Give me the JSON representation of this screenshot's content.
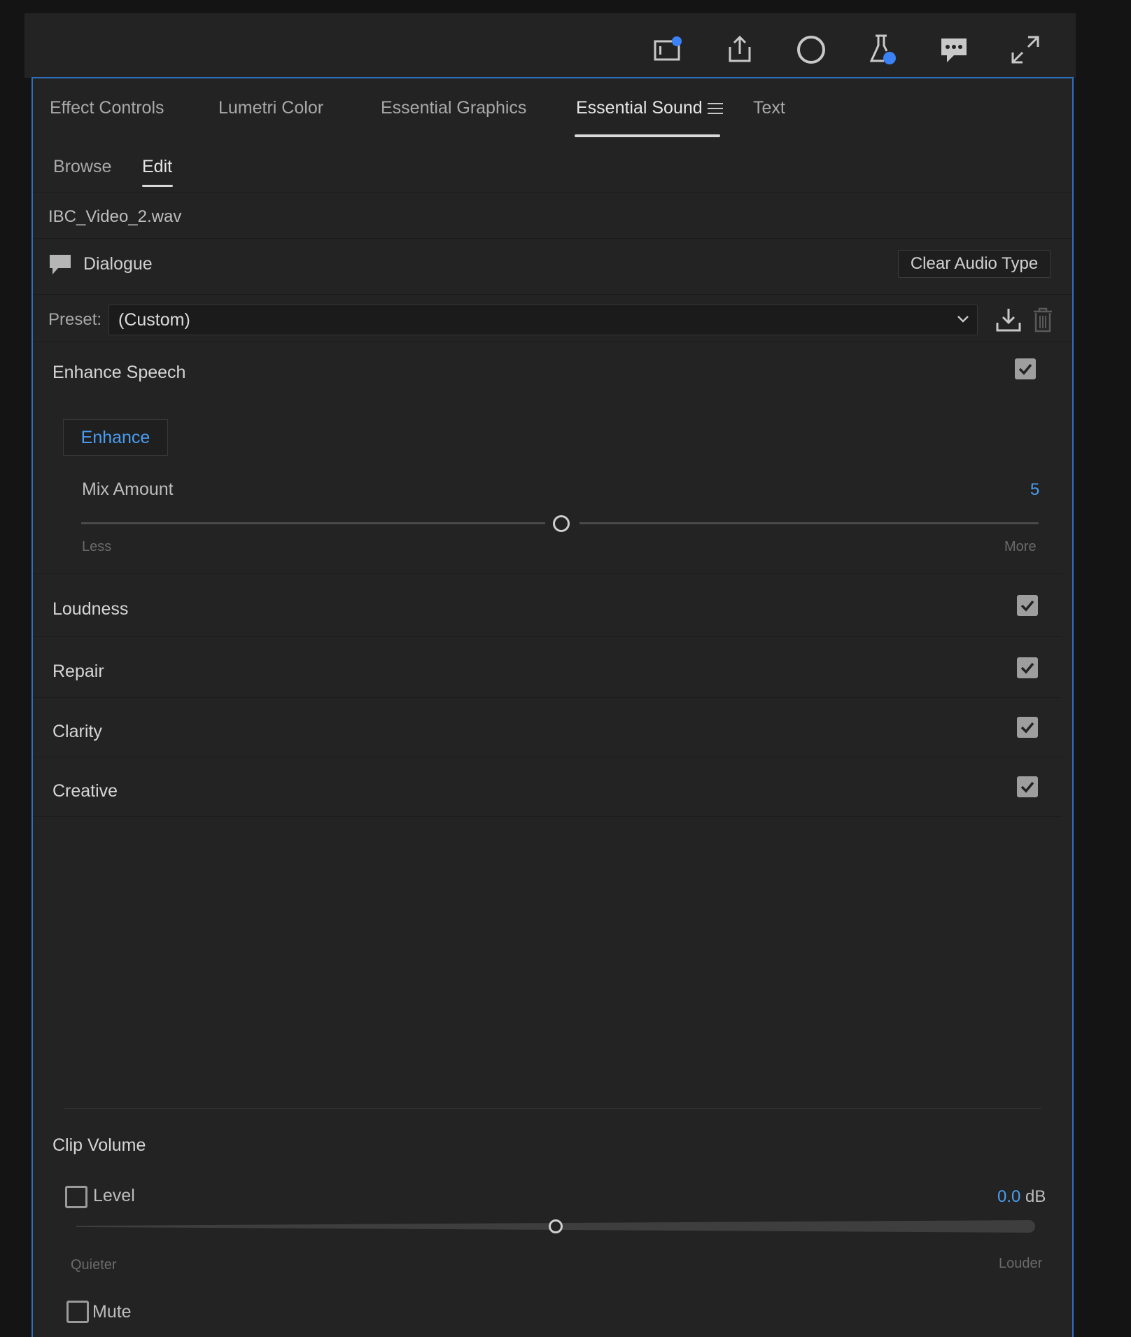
{
  "toolbar": {
    "icons": [
      "quick-export-icon",
      "share-icon",
      "record-icon",
      "beta-lab-icon",
      "comments-icon",
      "fullscreen-icon"
    ],
    "accent": "#3b82f6"
  },
  "tabs": {
    "effect_controls": "Effect Controls",
    "lumetri_color": "Lumetri Color",
    "essential_graphics": "Essential Graphics",
    "essential_sound": "Essential Sound",
    "text": "Text"
  },
  "subtabs": {
    "browse": "Browse",
    "edit": "Edit"
  },
  "clip": {
    "filename": "IBC_Video_2.wav"
  },
  "audio_type": {
    "label": "Dialogue",
    "clear_button": "Clear Audio Type"
  },
  "preset": {
    "label": "Preset:",
    "value": "(Custom)"
  },
  "enhance_speech": {
    "title": "Enhance Speech",
    "checked": true,
    "button": "Enhance",
    "mix_amount_label": "Mix Amount",
    "mix_amount_value": "5",
    "min_label": "Less",
    "max_label": "More"
  },
  "sections": {
    "loudness": "Loudness",
    "repair": "Repair",
    "clarity": "Clarity",
    "creative": "Creative"
  },
  "clip_volume": {
    "title": "Clip Volume",
    "level_label": "Level",
    "level_value": "0.0",
    "level_unit": "dB",
    "min_label": "Quieter",
    "max_label": "Louder",
    "mute_label": "Mute"
  },
  "colors": {
    "accent_blue": "#4a9df0",
    "panel_border": "#2f6fbf"
  }
}
